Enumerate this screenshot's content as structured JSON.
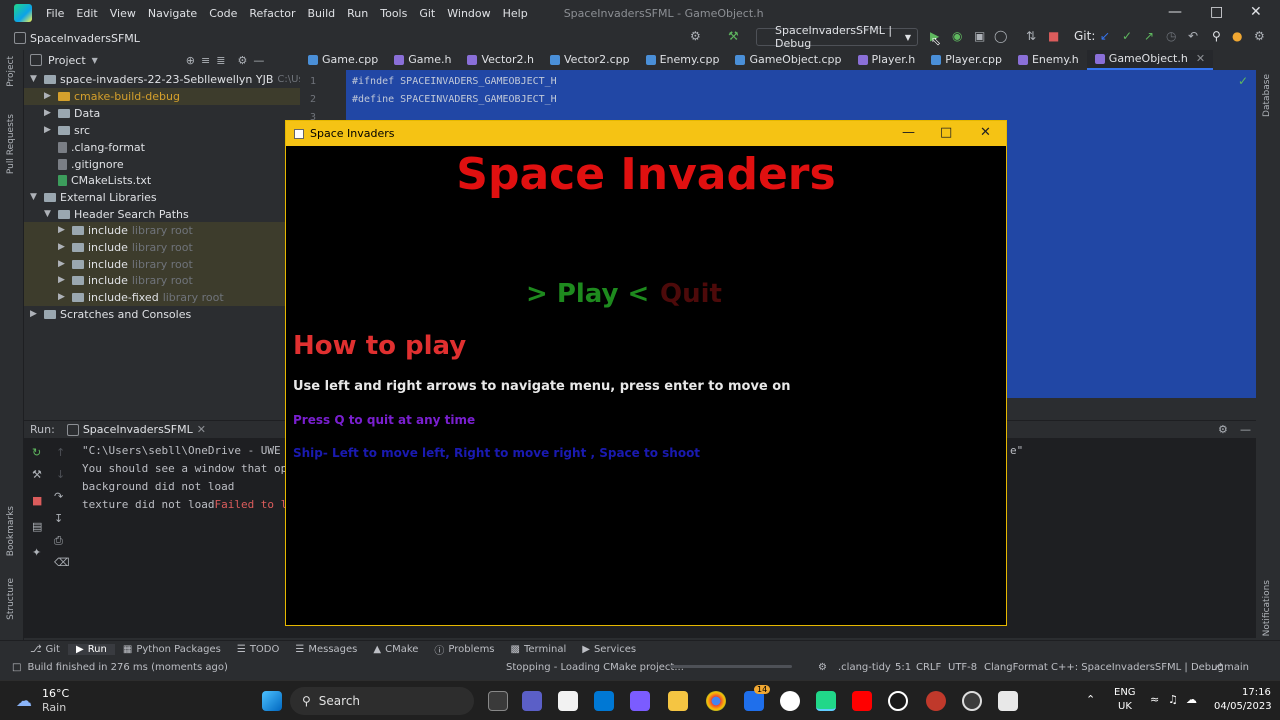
{
  "menu": {
    "items": [
      "File",
      "Edit",
      "View",
      "Navigate",
      "Code",
      "Refactor",
      "Build",
      "Run",
      "Tools",
      "Git",
      "Window",
      "Help"
    ],
    "window_title": "SpaceInvadersSFML - GameObject.h"
  },
  "toolbar": {
    "project_name": "SpaceInvadersSFML",
    "run_config": "SpaceInvadersSFML | Debug",
    "git_label": "Git:"
  },
  "project_panel": {
    "title": "Project",
    "root": "space-invaders-22-23-Sebllewellyn YJB",
    "root_path": "C:\\Users\\sebll",
    "items": [
      {
        "label": "cmake-build-debug",
        "type": "folder-orange"
      },
      {
        "label": "Data",
        "type": "folder"
      },
      {
        "label": "src",
        "type": "folder"
      },
      {
        "label": ".clang-format",
        "type": "file"
      },
      {
        "label": ".gitignore",
        "type": "file"
      },
      {
        "label": "CMakeLists.txt",
        "type": "file"
      }
    ],
    "external": "External Libraries",
    "header_paths": "Header Search Paths",
    "includes": [
      {
        "label": "include",
        "hint": "library root"
      },
      {
        "label": "include",
        "hint": "library root"
      },
      {
        "label": "include",
        "hint": "library root"
      },
      {
        "label": "include",
        "hint": "library root"
      },
      {
        "label": "include-fixed",
        "hint": "library root"
      }
    ],
    "scratches": "Scratches and Consoles"
  },
  "tabs": [
    {
      "label": "Game.cpp",
      "color": "#4a8fd8"
    },
    {
      "label": "Game.h",
      "color": "#8a6fd8"
    },
    {
      "label": "Vector2.h",
      "color": "#8a6fd8"
    },
    {
      "label": "Vector2.cpp",
      "color": "#4a8fd8"
    },
    {
      "label": "Enemy.cpp",
      "color": "#4a8fd8"
    },
    {
      "label": "GameObject.cpp",
      "color": "#4a8fd8"
    },
    {
      "label": "Player.h",
      "color": "#8a6fd8"
    },
    {
      "label": "Player.cpp",
      "color": "#4a8fd8"
    },
    {
      "label": "Enemy.h",
      "color": "#8a6fd8"
    },
    {
      "label": "GameObject.h",
      "color": "#8a6fd8",
      "active": true
    }
  ],
  "editor": {
    "lines": [
      {
        "n": "1",
        "code": "#ifndef SPACEINVADERS_GAMEOBJECT_H"
      },
      {
        "n": "2",
        "code": "#define SPACEINVADERS_GAMEOBJECT_H"
      },
      {
        "n": "3",
        "code": ""
      }
    ]
  },
  "run_panel": {
    "label": "Run:",
    "config": "SpaceInvadersSFML",
    "output": [
      "\"C:\\Users\\sebll\\OneDrive - UWE",
      "You should see a window that op",
      "background did not load",
      "texture did not load"
    ],
    "error_fragment": "Failed to l",
    "trailing_quote": "e\""
  },
  "game": {
    "window_title": "Space Invaders",
    "title": "Space Invaders",
    "play": "> Play <",
    "quit": "Quit",
    "howto": "How to play",
    "line1": "Use left and right arrows to navigate menu, press enter to move on",
    "line2": "Press Q to quit at any time",
    "line3": "Ship- Left to move left, Right to move right , Space to shoot"
  },
  "side_labels": {
    "left": [
      "Project",
      "Pull Requests",
      "Bookmarks",
      "Structure"
    ],
    "right": [
      "Database",
      "Notifications"
    ]
  },
  "toolwindows": [
    "Git",
    "Run",
    "Python Packages",
    "TODO",
    "Messages",
    "CMake",
    "Problems",
    "Terminal",
    "Services"
  ],
  "status": {
    "left": "Build finished in 276 ms (moments ago)",
    "middle": "Stopping - Loading CMake project...",
    "clang_tidy": ".clang-tidy",
    "position": "5:1",
    "line_sep": "CRLF",
    "encoding": "UTF-8",
    "formatter": "ClangFormat",
    "context": "C++: SpaceInvadersSFML | Debug",
    "branch": "main"
  },
  "taskbar": {
    "weather_temp": "16°C",
    "weather_desc": "Rain",
    "search": "Search",
    "badge": "14",
    "lang1": "ENG",
    "lang2": "UK",
    "time": "17:16",
    "date": "04/05/2023"
  }
}
